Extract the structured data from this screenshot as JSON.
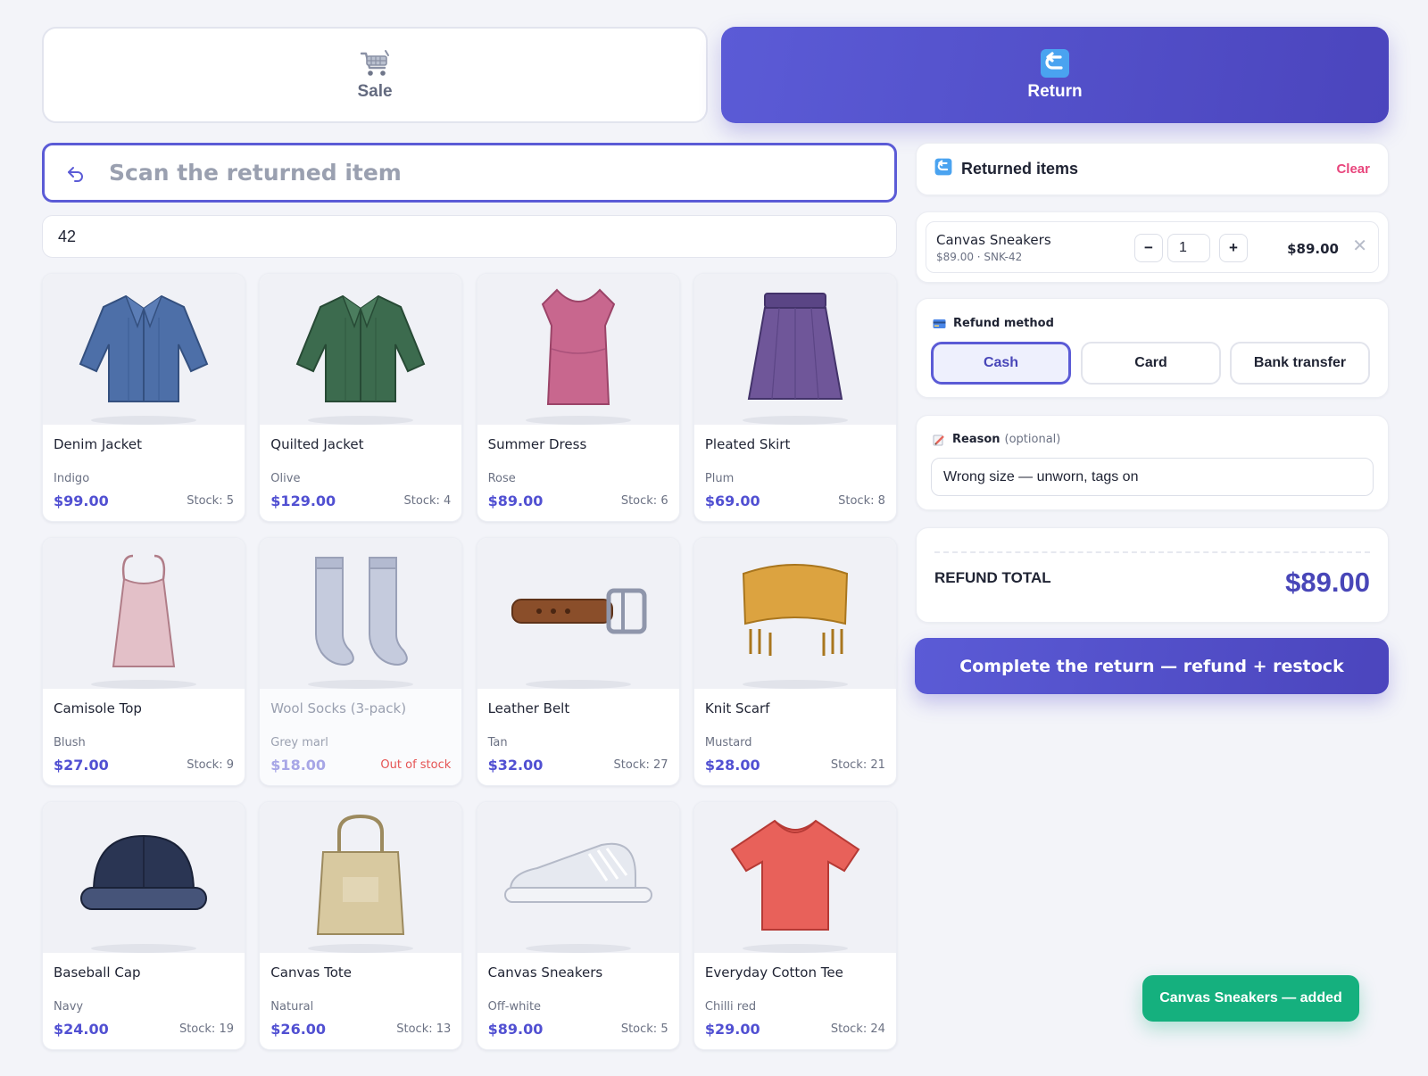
{
  "modes": {
    "sale": {
      "label": "Sale",
      "icon": "shopping-cart-icon"
    },
    "return": {
      "label": "Return",
      "icon": "return-arrow-icon",
      "active": true
    }
  },
  "scan": {
    "placeholder": "Scan the returned item",
    "value": ""
  },
  "filter": {
    "value": "42"
  },
  "products": [
    {
      "name": "Denim Jacket",
      "color": "Indigo",
      "price": "$99.00",
      "stock": "Stock: 5",
      "icon": "jacket-icon"
    },
    {
      "name": "Quilted Jacket",
      "color": "Olive",
      "price": "$129.00",
      "stock": "Stock: 4",
      "icon": "jacket-icon"
    },
    {
      "name": "Summer Dress",
      "color": "Rose",
      "price": "$89.00",
      "stock": "Stock: 6",
      "icon": "dress-icon"
    },
    {
      "name": "Pleated Skirt",
      "color": "Plum",
      "price": "$69.00",
      "stock": "Stock: 8",
      "icon": "skirt-icon"
    },
    {
      "name": "Camisole Top",
      "color": "Blush",
      "price": "$27.00",
      "stock": "Stock: 9",
      "icon": "camisole-icon"
    },
    {
      "name": "Wool Socks (3-pack)",
      "color": "Grey marl",
      "price": "$18.00",
      "stock": "Out of stock",
      "icon": "socks-icon",
      "out_of_stock": true
    },
    {
      "name": "Leather Belt",
      "color": "Tan",
      "price": "$32.00",
      "stock": "Stock: 27",
      "icon": "belt-icon"
    },
    {
      "name": "Knit Scarf",
      "color": "Mustard",
      "price": "$28.00",
      "stock": "Stock: 21",
      "icon": "scarf-icon"
    },
    {
      "name": "Baseball Cap",
      "color": "Navy",
      "price": "$24.00",
      "stock": "Stock: 19",
      "icon": "cap-icon"
    },
    {
      "name": "Canvas Tote",
      "color": "Natural",
      "price": "$26.00",
      "stock": "Stock: 13",
      "icon": "tote-bag-icon"
    },
    {
      "name": "Canvas Sneakers",
      "color": "Off-white",
      "price": "$89.00",
      "stock": "Stock: 5",
      "icon": "sneaker-icon"
    },
    {
      "name": "Everyday Cotton Tee",
      "color": "Chilli red",
      "price": "$29.00",
      "stock": "Stock: 24",
      "icon": "tshirt-icon"
    }
  ],
  "returned": {
    "title": "Returned items",
    "clear_label": "Clear",
    "items": [
      {
        "name": "Canvas Sneakers",
        "meta": "$89.00 · SNK-42",
        "qty": "1",
        "total": "$89.00"
      }
    ]
  },
  "refund_method": {
    "title": "Refund method",
    "options": [
      "Cash",
      "Card",
      "Bank transfer"
    ],
    "selected": "Cash"
  },
  "reason": {
    "title": "Reason",
    "optional_label": "(optional)",
    "value": "Wrong size — unworn, tags on"
  },
  "refund_total": {
    "label": "REFUND TOTAL",
    "value": "$89.00"
  },
  "complete_button": {
    "label": "Complete the return — refund + restock"
  },
  "toast": {
    "text": "Canvas Sneakers — added"
  },
  "colors": {
    "accent": "#5b5bd6",
    "danger": "#e8457c",
    "success": "#15b07e"
  }
}
